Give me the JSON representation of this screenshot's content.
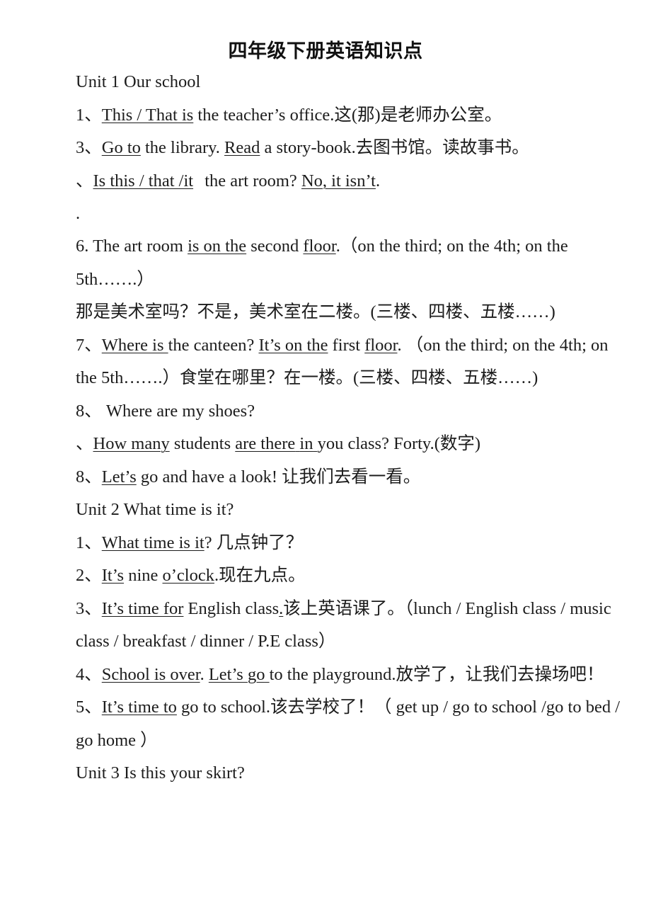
{
  "document": {
    "title": "四年级下册英语知识点",
    "sections": [
      {
        "unit_heading": "Unit 1 Our school",
        "items": [
          {
            "number": "1、",
            "underlined_1": "This / That is",
            "rest_1": " the teacher’s office.这(那)是老师办公室。"
          },
          {
            "number": "3、",
            "underlined_1": "Go to",
            "mid_1": " the library. ",
            "underlined_2": "Read",
            "rest_1": " a story-book.去图书馆。读故事书。"
          },
          {
            "number": "、",
            "underlined_1": "Is this / that /it",
            "mid_1": " the art room? ",
            "underlined_2": "No, it isn’t",
            "rest_1": "."
          },
          {
            "number": ".",
            "rest_1": ""
          },
          {
            "number": "6. ",
            "pre_1": "The art room ",
            "underlined_1": "is on the",
            "mid_1": " second ",
            "underlined_2": "floor",
            "rest_1": ".（on the third;  on the 4th;  on the 5th…….）"
          },
          {
            "number": "",
            "rest_1": "那是美术室吗？不是，美术室在二楼。(三楼、四楼、五楼……)"
          },
          {
            "number": "7、",
            "underlined_1": "Where is",
            "mid_1": " the canteen? ",
            "underlined_2": "It’s on the",
            "mid_2": " first ",
            "underlined_3": "floor",
            "rest_1": ".  （on the third;  on the 4th;  on the 5th…….）食堂在哪里？在一楼。(三楼、四楼、五楼……)"
          },
          {
            "number": "8、",
            "rest_1": " Where are my shoes?"
          },
          {
            "number": "、",
            "underlined_1": "How many",
            "mid_1": " students ",
            "underlined_2": "are there",
            "mid_2": " ",
            "underlined_3": "in",
            "rest_1": " you class?  Forty.(数字)"
          },
          {
            "number": "8、",
            "underlined_1": "Let’s",
            "rest_1": " go and have a look!  让我们去看一看。"
          }
        ]
      },
      {
        "unit_heading": "Unit 2 What time is it?",
        "items": [
          {
            "number": "1、",
            "underlined_1": "What time is it",
            "rest_1": "?  几点钟了？"
          },
          {
            "number": "2、",
            "underlined_1": "It’s",
            "mid_1": " nine ",
            "underlined_2": "o’clock",
            "rest_1": ".现在九点。"
          },
          {
            "number": "3、",
            "underlined_1": "It’s time for",
            "mid_1": " English class",
            "underlined_2": ".",
            "rest_1": "该上英语课了。（lunch  / English class  / music class    / breakfast  / dinner /    P.E class）"
          },
          {
            "number": "4、",
            "underlined_1": "School is over",
            "mid_1": ". ",
            "underlined_2": "Let’s go",
            "rest_1": " to the playground.放学了，让我们去操场吧！"
          },
          {
            "number": "5、",
            "underlined_1": "It’s time to",
            "rest_1": " go to school.该去学校了！（ get up / go to school  /go to bed  / go home  ）"
          }
        ]
      },
      {
        "unit_heading": " Unit 3 Is this your skirt?",
        "items": []
      }
    ]
  }
}
